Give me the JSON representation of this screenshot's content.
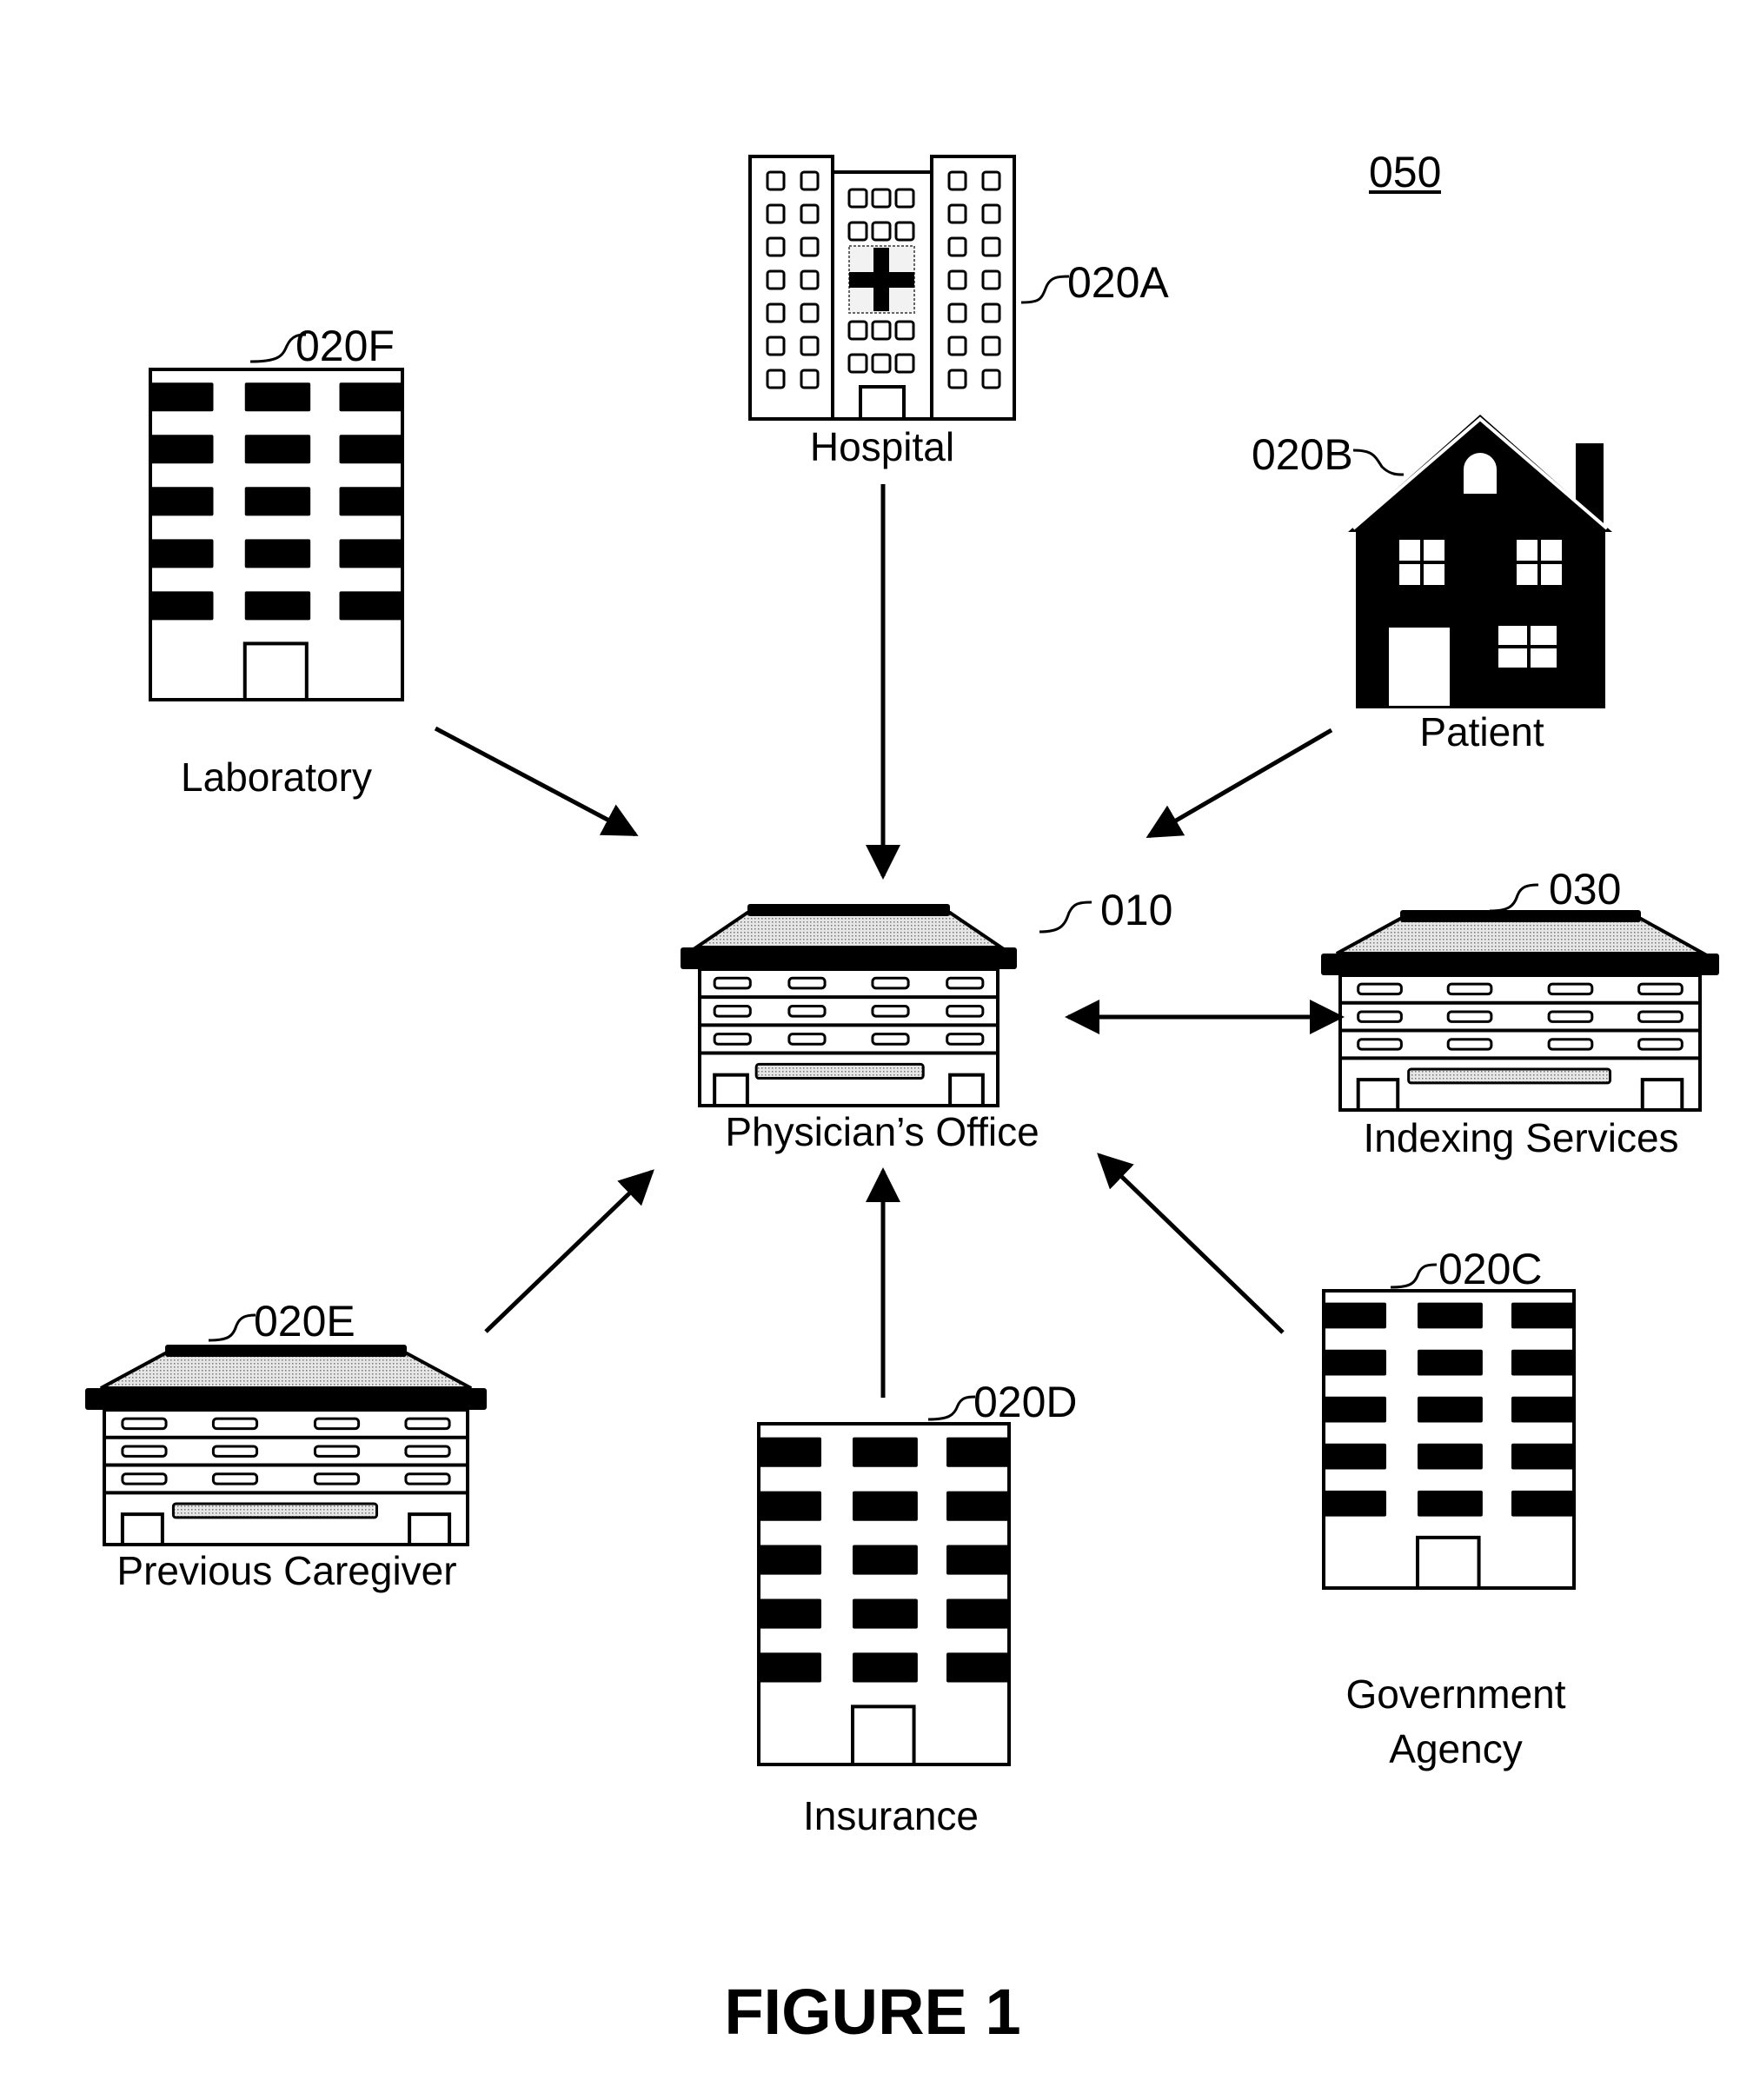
{
  "figure": {
    "title": "FIGURE 1",
    "system_ref": "050"
  },
  "nodes": {
    "hospital": {
      "label": "Hospital",
      "ref": "020A"
    },
    "patient": {
      "label": "Patient",
      "ref": "020B"
    },
    "government": {
      "label_line1": "Government",
      "label_line2": "Agency",
      "ref": "020C"
    },
    "insurance": {
      "label": "Insurance",
      "ref": "020D"
    },
    "previous_caregiver": {
      "label": "Previous Caregiver",
      "ref": "020E"
    },
    "laboratory": {
      "label": "Laboratory",
      "ref": "020F"
    },
    "physicians_office": {
      "label": "Physician’s Office",
      "ref": "010"
    },
    "indexing_services": {
      "label": "Indexing Services",
      "ref": "030"
    }
  },
  "edges": [
    {
      "from": "hospital",
      "to": "physicians_office",
      "direction": "one-way"
    },
    {
      "from": "laboratory",
      "to": "physicians_office",
      "direction": "one-way"
    },
    {
      "from": "patient",
      "to": "physicians_office",
      "direction": "one-way"
    },
    {
      "from": "previous_caregiver",
      "to": "physicians_office",
      "direction": "one-way"
    },
    {
      "from": "insurance",
      "to": "physicians_office",
      "direction": "one-way"
    },
    {
      "from": "government",
      "to": "physicians_office",
      "direction": "one-way"
    },
    {
      "from": "physicians_office",
      "to": "indexing_services",
      "direction": "two-way"
    }
  ]
}
